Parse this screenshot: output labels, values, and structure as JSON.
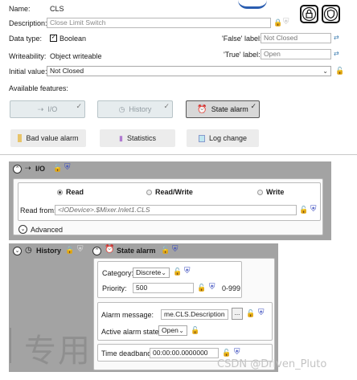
{
  "header": {
    "name_label": "Name:",
    "name_value": "CLS",
    "description_label": "Description:",
    "description_placeholder": "Close Limit Switch",
    "datatype_label": "Data type:",
    "datatype_value": "Boolean",
    "writeability_label": "Writeability:",
    "writeability_value": "Object writeable",
    "false_label": "'False' label:",
    "false_value": "Not Closed",
    "true_label": "'True' label:",
    "true_value": "Open",
    "initial_label": "Initial value:",
    "initial_value": "Not Closed",
    "available_label": "Available features:"
  },
  "features": {
    "io": "I/O",
    "history": "History",
    "state_alarm": "State alarm",
    "bad_value_alarm": "Bad value alarm",
    "statistics": "Statistics",
    "log_change": "Log change"
  },
  "io_panel": {
    "title": "I/O",
    "read": "Read",
    "read_write": "Read/Write",
    "write": "Write",
    "read_from_label": "Read from:",
    "read_from_value": "<IODevice>.$Mixer.Inlet1.CLS",
    "advanced": "Advanced"
  },
  "history_panel": {
    "title": "History"
  },
  "alarm_panel": {
    "title": "State alarm",
    "category_label": "Category:",
    "category_value": "Discrete",
    "priority_label": "Priority:",
    "priority_value": "500",
    "priority_range": "0-999",
    "message_label": "Alarm message:",
    "message_value": "me.CLS.Description",
    "browse": "...",
    "active_state_label": "Active alarm state:",
    "active_state_value": "Open",
    "deadband_label": "Time deadband:",
    "deadband_value": "00:00:00.0000000"
  },
  "watermark": {
    "cjk": "专用",
    "credit": "CSDN @Driven_Pluto"
  },
  "colors": {
    "panel_grey": "#9a9a9a",
    "lock_green": "#3d8f3d",
    "shield_blue": "#3e4fbf"
  }
}
